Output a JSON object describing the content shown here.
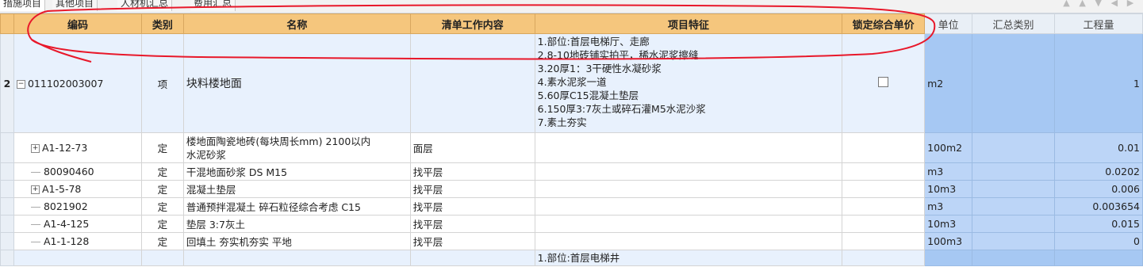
{
  "tabs": [
    "措施项目",
    "其他项目",
    "人材机汇总",
    "费用汇总"
  ],
  "columns": {
    "code": "编码",
    "type": "类别",
    "name": "名称",
    "work": "清单工作内容",
    "features": "项目特征",
    "lock": "锁定综合单价",
    "unit": "单位",
    "category": "汇总类别",
    "qty": "工程量"
  },
  "rows": [
    {
      "rownum": "2",
      "code": "011102003007",
      "type": "项",
      "name": "块料楼地面",
      "work": "",
      "features": [
        "1.部位:首层电梯厅、走廊",
        "2.8-10地砖铺实拍平，稀水泥浆擦缝",
        "3.20厚1：3干硬性水凝砂浆",
        "4.素水泥浆一道",
        "5.60厚C15混凝土垫层",
        "6.150厚3:7灰土或碎石灌M5水泥沙浆",
        "7.素土夯实"
      ],
      "unit": "m2",
      "qty": "1"
    },
    {
      "code": "A1-12-73",
      "expander": "+",
      "type": "定",
      "name": "楼地面陶瓷地砖(每块周长mm) 2100以内",
      "name2": "水泥砂浆",
      "work": "面层",
      "unit": "100m2",
      "qty": "0.01"
    },
    {
      "code": "80090460",
      "type": "定",
      "name": "干混地面砂浆 DS M15",
      "work": "找平层",
      "unit": "m3",
      "qty": "0.0202"
    },
    {
      "code": "A1-5-78",
      "expander": "+",
      "type": "定",
      "name": "混凝土垫层",
      "work": "找平层",
      "unit": "10m3",
      "qty": "0.006"
    },
    {
      "code": "8021902",
      "type": "定",
      "name": "普通预拌混凝土 碎石粒径综合考虑 C15",
      "work": "找平层",
      "unit": "m3",
      "qty": "0.003654"
    },
    {
      "code": "A1-4-125",
      "type": "定",
      "name": "垫层 3:7灰土",
      "work": "找平层",
      "unit": "10m3",
      "qty": "0.015"
    },
    {
      "code": "A1-1-128",
      "type": "定",
      "name": "回填土 夯实机夯实 平地",
      "work": "找平层",
      "unit": "100m3",
      "qty": "0"
    },
    {
      "feature_first": "1.部位:首层电梯井"
    }
  ]
}
